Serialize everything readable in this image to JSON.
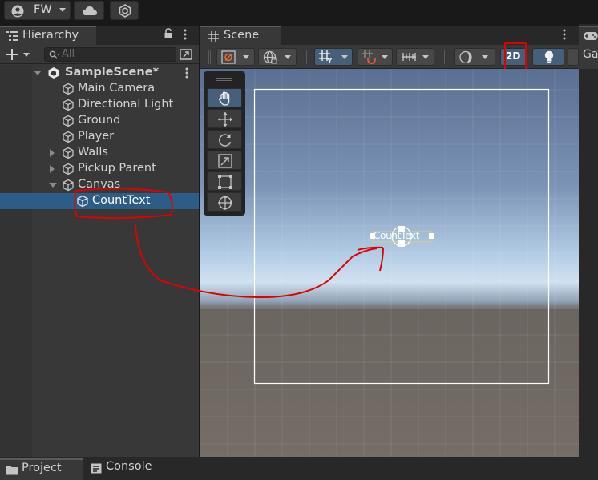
{
  "topbar": {
    "account_label": "FW"
  },
  "hierarchy": {
    "tab_label": "Hierarchy",
    "search_placeholder": "All",
    "items": [
      {
        "label": "SampleScene*"
      },
      {
        "label": "Main Camera"
      },
      {
        "label": "Directional Light"
      },
      {
        "label": "Ground"
      },
      {
        "label": "Player"
      },
      {
        "label": "Walls"
      },
      {
        "label": "Pickup Parent"
      },
      {
        "label": "Canvas"
      },
      {
        "label": "CountText"
      }
    ]
  },
  "scene": {
    "tab_label": "Scene",
    "mode_2d_label": "2D",
    "object_label": "CountText"
  },
  "game": {
    "tab_label_partial": "Ga"
  },
  "bottom": {
    "project_tab": "Project",
    "console_tab": "Console"
  },
  "colors": {
    "selection": "#2c5d87",
    "annotation_red": "#e00000",
    "toggle_on": "#46607c"
  }
}
